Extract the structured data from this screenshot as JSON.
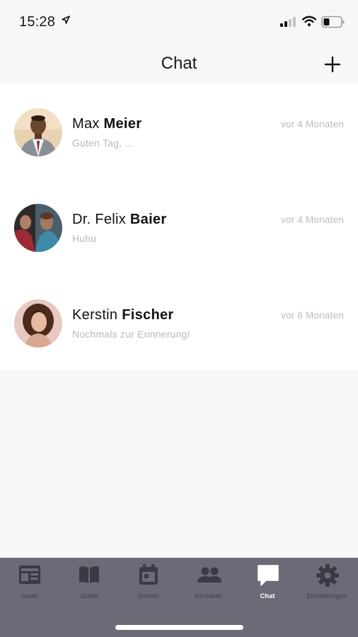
{
  "status_bar": {
    "time": "15:28"
  },
  "header": {
    "title": "Chat"
  },
  "chats": [
    {
      "first_name": "Max",
      "last_name": "Meier",
      "preview": "Guten Tag, ...",
      "timestamp": "vor 4 Monaten"
    },
    {
      "first_name": "Dr. Felix",
      "last_name": "Baier",
      "preview": "Huhu",
      "timestamp": "vor 4 Monaten"
    },
    {
      "first_name": "Kerstin",
      "last_name": "Fischer",
      "preview": "Nochmals zur Erinnerung!",
      "timestamp": "vor 6 Monaten"
    }
  ],
  "tabs": [
    {
      "label": "News",
      "icon": "newspaper-icon"
    },
    {
      "label": "Guide",
      "icon": "book-icon"
    },
    {
      "label": "Events",
      "icon": "calendar-icon"
    },
    {
      "label": "Kontakte",
      "icon": "people-icon"
    },
    {
      "label": "Chat",
      "icon": "chat-bubble-icon",
      "active": true
    },
    {
      "label": "Einstellungen",
      "icon": "gear-icon"
    }
  ],
  "colors": {
    "tab_bar_bg": "#6b6b78",
    "tab_icon_inactive": "#3a3a44",
    "tab_icon_active": "#ffffff",
    "muted_text": "#b8b8b8"
  }
}
